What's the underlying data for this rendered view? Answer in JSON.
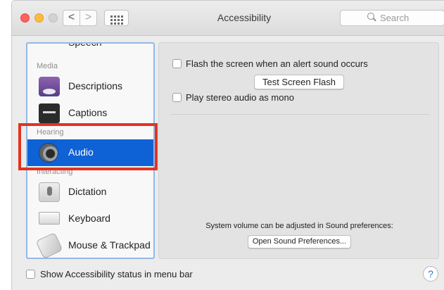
{
  "window": {
    "title": "Accessibility",
    "search_placeholder": "Search",
    "nav_back": "<",
    "nav_forward": ">"
  },
  "sidebar": {
    "items": [
      {
        "label": "Speech",
        "icon": "speech-icon"
      },
      {
        "header": "Media"
      },
      {
        "label": "Descriptions",
        "icon": "descriptions-icon"
      },
      {
        "label": "Captions",
        "icon": "captions-icon"
      },
      {
        "header": "Hearing"
      },
      {
        "label": "Audio",
        "icon": "audio-speaker-icon",
        "selected": true
      },
      {
        "header": "Interacting"
      },
      {
        "label": "Dictation",
        "icon": "microphone-icon"
      },
      {
        "label": "Keyboard",
        "icon": "keyboard-icon"
      },
      {
        "label": "Mouse & Trackpad",
        "icon": "mouse-icon"
      }
    ]
  },
  "panel": {
    "flash_label": "Flash the screen when an alert sound occurs",
    "test_flash_button": "Test Screen Flash",
    "mono_label": "Play stereo audio as mono",
    "note": "System volume can be adjusted in Sound preferences:",
    "open_sound_button": "Open Sound Preferences..."
  },
  "footer": {
    "status_label": "Show Accessibility status in menu bar",
    "help": "?"
  },
  "colors": {
    "selection": "#0f62d6",
    "highlight": "#e2331e",
    "sidebar_border": "#91b8e8"
  }
}
